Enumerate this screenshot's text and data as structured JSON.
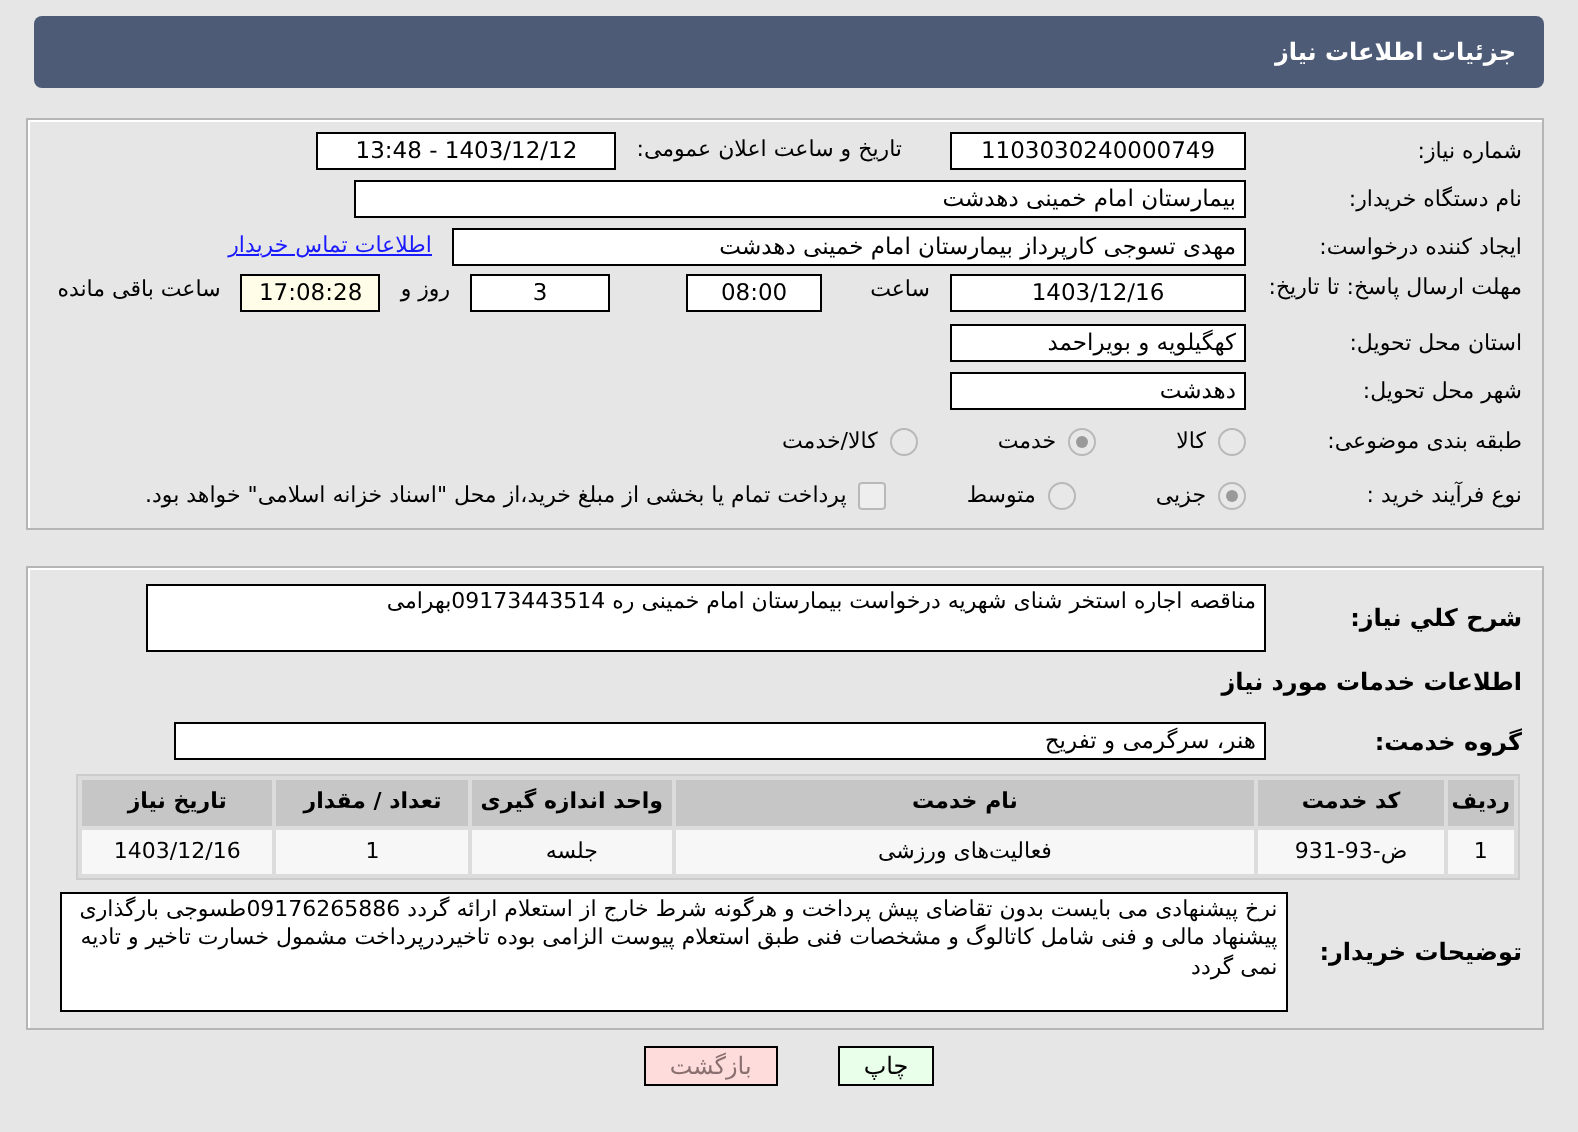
{
  "header": {
    "title": "جزئیات اطلاعات نیاز"
  },
  "need_number": {
    "label": "شماره نیاز:",
    "value": "1103030240000749"
  },
  "announce": {
    "label": "تاریخ و ساعت اعلان عمومی:",
    "value": "1403/12/12 - 13:48"
  },
  "buyer": {
    "label": "نام دستگاه خریدار:",
    "value": "بیمارستان امام خمینی دهدشت"
  },
  "creator": {
    "label": "ایجاد کننده درخواست:",
    "value": "مهدی تسوجی کارپرداز بیمارستان امام خمینی دهدشت",
    "link": "اطلاعات تماس خریدار"
  },
  "deadline": {
    "label": "مهلت ارسال پاسخ: تا تاریخ:",
    "date": "1403/12/16",
    "time_label": "ساعت",
    "time": "08:00",
    "days": "3",
    "days_label": "روز و",
    "remaining": "17:08:28",
    "remaining_label": "ساعت باقی مانده"
  },
  "province": {
    "label": "استان محل تحویل:",
    "value": "کهگیلویه و بویراحمد"
  },
  "city": {
    "label": "شهر محل تحویل:",
    "value": "دهدشت"
  },
  "category": {
    "label": "طبقه بندی موضوعی:",
    "options": [
      {
        "label": "کالا",
        "selected": false
      },
      {
        "label": "خدمت",
        "selected": true
      },
      {
        "label": "کالا/خدمت",
        "selected": false
      }
    ]
  },
  "process": {
    "label": "نوع فرآیند خرید :",
    "options": [
      {
        "label": "جزیی",
        "selected": true
      },
      {
        "label": "متوسط",
        "selected": false
      }
    ],
    "payment": {
      "label": "پرداخت تمام یا بخشی از مبلغ خرید،از محل \"اسناد خزانه اسلامی\" خواهد بود.",
      "checked": false
    }
  },
  "description": {
    "label": "شرح كلي نياز:",
    "value": "مناقصه اجاره استخر شنای شهریه درخواست بیمارستان امام خمینی ره 09173443514بهرامی"
  },
  "services_heading": "اطلاعات خدمات مورد نیاز",
  "service_group": {
    "label": "گروه خدمت:",
    "value": "هنر، سرگرمی و تفریح"
  },
  "table": {
    "columns": [
      "ردیف",
      "کد خدمت",
      "نام خدمت",
      "واحد اندازه گیری",
      "تعداد / مقدار",
      "تاریخ نیاز"
    ],
    "rows": [
      [
        "1",
        "ض-93-931",
        "فعالیت‌های ورزشی",
        "جلسه",
        "1",
        "1403/12/16"
      ]
    ]
  },
  "buyer_notes": {
    "label": "توضیحات خریدار:",
    "value": "نرخ پیشنهادی می بایست بدون تقاضای پیش پرداخت و هرگونه شرط خارج از استعلام ارائه گردد 09176265886طسوجی بارگذاری پیشنهاد مالی و فنی شامل کاتالوگ و مشخصات فنی طبق استعلام پیوست الزامی بوده تاخیردرپرداخت مشمول خسارت تاخیر و تادیه نمی گردد"
  },
  "buttons": [
    {
      "label": "چاپ",
      "kind": "print"
    },
    {
      "label": "بازگشت",
      "kind": "back"
    }
  ]
}
